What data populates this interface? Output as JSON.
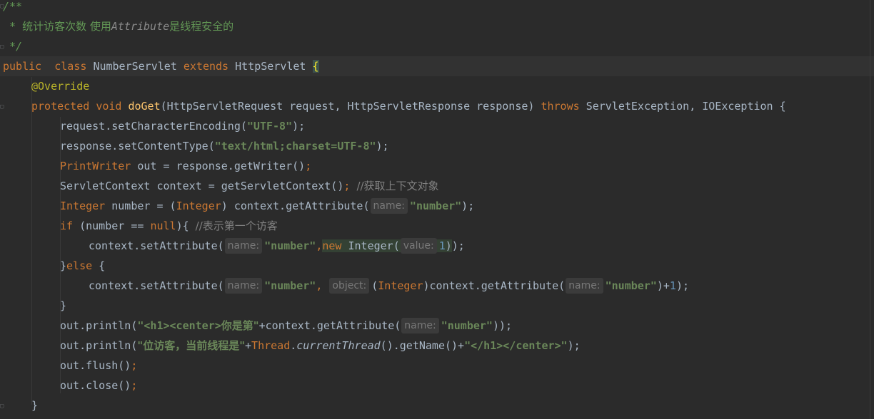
{
  "editor": {
    "lines": [
      "/**",
      " * 统计访客次数 使用Attribute是线程安全的",
      " */",
      "public  class NumberServlet extends HttpServlet {",
      "@Override",
      "protected void doGet(HttpServletRequest request, HttpServletResponse response) throws ServletException, IOException {",
      "request.setCharacterEncoding(\"UTF-8\");",
      "response.setContentType(\"text/html;charset=UTF-8\");",
      "PrintWriter out = response.getWriter();",
      "ServletContext context = getServletContext(); //获取上下文对象",
      "Integer number = (Integer) context.getAttribute(name: \"number\");",
      "if (number == null){ //表示第一个访客",
      "context.setAttribute(name: \"number\",new Integer(value: 1));",
      "}else {",
      "context.setAttribute(name: \"number\", object: (Integer)context.getAttribute(name: \"number\")+1);",
      "}",
      "out.println(\"<h1><center>你是第\"+context.getAttribute(name: \"number\"));",
      "out.println(\"位访客，当前线程是\"+Thread.currentThread().getName()+\"</h1></center>\");",
      "out.flush();",
      "out.close();",
      "}"
    ],
    "tokens": {
      "doc_open": "/**",
      "doc_star": " * ",
      "doc_text_1": "统计访客次数 使用",
      "doc_attr": "Attribute",
      "doc_text_2": "是线程安全的",
      "doc_close": " */",
      "kw_public": "public",
      "kw_class": "class",
      "cls_name": "NumberServlet",
      "kw_extends": "extends",
      "cls_parent": "HttpServlet",
      "brace_open": "{",
      "brace_close": "}",
      "annotation": "@Override",
      "kw_protected": "protected",
      "kw_void": "void",
      "fn_doget": "doGet",
      "param_req_type": "HttpServletRequest",
      "param_req": "request",
      "param_resp_type": "HttpServletResponse",
      "param_resp": "response",
      "kw_throws": "throws",
      "exc_1": "ServletException",
      "exc_2": "IOException",
      "set_enc": "request.setCharacterEncoding(",
      "str_utf8": "\"UTF-8\"",
      "paren_semi": ");",
      "set_ct": "response.setContentType(",
      "str_ct": "\"text/html;charset=UTF-8\"",
      "type_printwriter": "PrintWriter",
      "out_assign": " out = response.getWriter()",
      "semi": ";",
      "type_ctx": "ServletContext",
      "ctx_assign": " context = getServletContext()",
      "cmt_ctx": "//获取上下文对象",
      "type_integer": "Integer",
      "num_assign": " number = (",
      "cast_close": ") context.getAttribute(",
      "hint_name": "name:",
      "hint_value": "value:",
      "hint_object": "object:",
      "str_number": "\"number\"",
      "kw_if": "if",
      "if_cond_1": " (number == ",
      "kw_null": "null",
      "if_cond_2": "){ ",
      "cmt_first": "//表示第一个访客",
      "set_attr": "context.setAttribute(",
      "comma": ",",
      "kw_new": "new",
      "new_integer": " Integer(",
      "num_one": "1",
      "paren_close2": "));",
      "else_open": "}",
      "kw_else": "else",
      "else_brace": " {",
      "cast_open": "(",
      "get_attr_cast": ")context.getAttribute(",
      "plus_one_close": ")+",
      "paren_semi_close": ");",
      "println_1": "out.println(",
      "str_h1": "\"<h1><center>",
      "str_youare": "你是第\"",
      "concat_get": "+context.getAttribute(",
      "str_visitor": "\"位访客，当前线程是\"",
      "plus": "+",
      "thread_cls": "Thread",
      "dot": ".",
      "current_thread": "currentThread",
      "get_name": "().getName()+",
      "str_close_tags": "\"</h1></center>\"",
      "flush": "out.flush()",
      "close": "out.close()"
    }
  }
}
